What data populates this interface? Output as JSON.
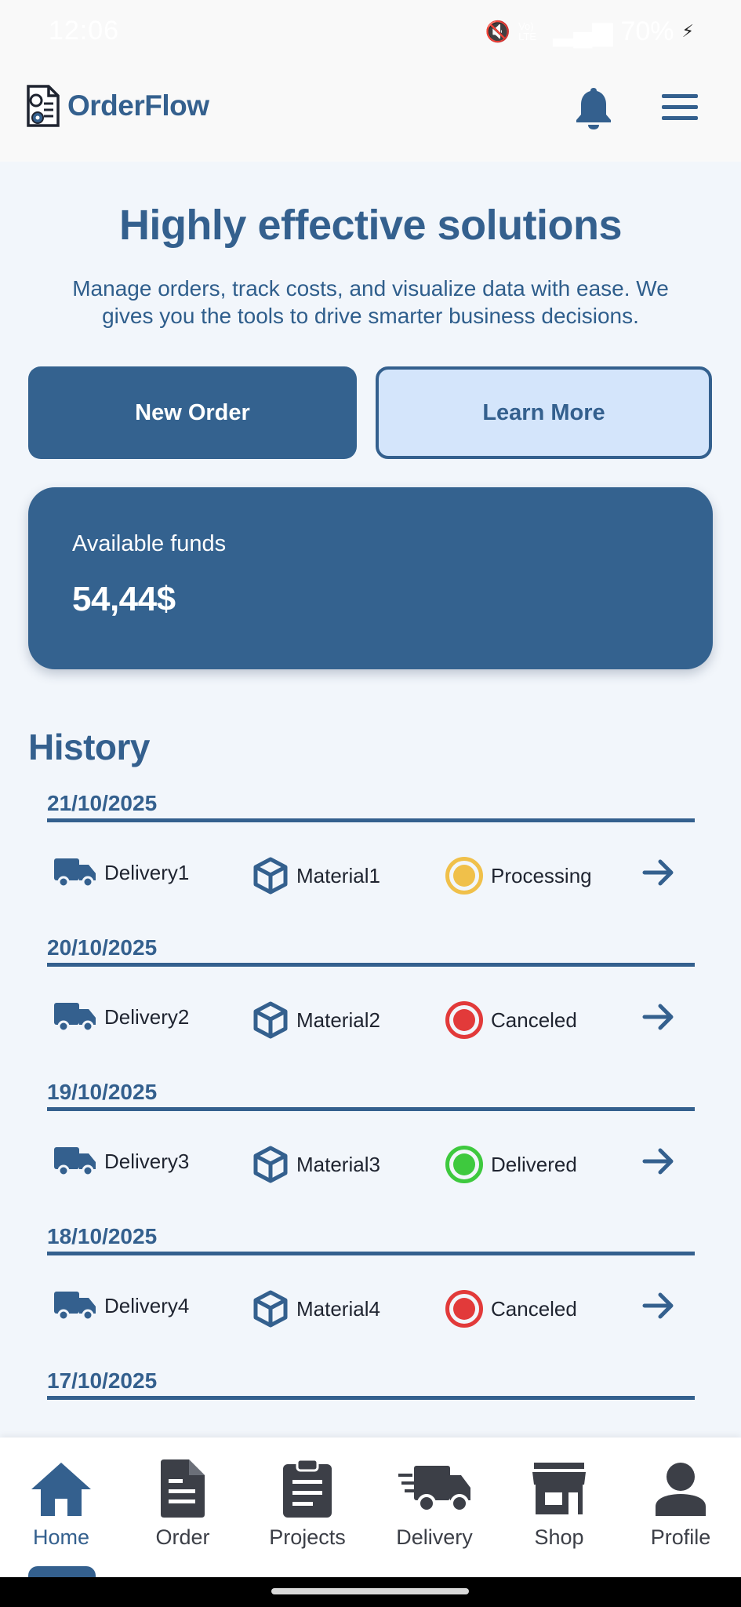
{
  "status_bar": {
    "time": "12:06",
    "network": "Vo) LTE",
    "battery": "70%"
  },
  "header": {
    "app_name": "OrderFlow"
  },
  "hero": {
    "title": "Highly effective solutions",
    "subtitle": "Manage orders, track costs, and visualize data with ease. We gives you the tools to drive smarter business decisions."
  },
  "actions": {
    "primary": "New Order",
    "secondary": "Learn More"
  },
  "funds": {
    "label": "Available funds",
    "value": "54,44$"
  },
  "history": {
    "title": "History",
    "groups": [
      {
        "date": "21/10/2025",
        "delivery": "Delivery1",
        "material": "Material1",
        "status": "Processing"
      },
      {
        "date": "20/10/2025",
        "delivery": "Delivery2",
        "material": "Material2",
        "status": "Canceled"
      },
      {
        "date": "19/10/2025",
        "delivery": "Delivery3",
        "material": "Material3",
        "status": "Delivered"
      },
      {
        "date": "18/10/2025",
        "delivery": "Delivery4",
        "material": "Material4",
        "status": "Canceled"
      },
      {
        "date": "17/10/2025"
      }
    ],
    "status_colors": {
      "Processing": "#f0c04a",
      "Canceled": "#e23a3a",
      "Delivered": "#3ec93e"
    }
  },
  "nav": {
    "items": [
      {
        "label": "Home",
        "icon": "home-icon"
      },
      {
        "label": "Order",
        "icon": "document-icon"
      },
      {
        "label": "Projects",
        "icon": "clipboard-icon"
      },
      {
        "label": "Delivery",
        "icon": "truck-icon"
      },
      {
        "label": "Shop",
        "icon": "store-icon"
      },
      {
        "label": "Profile",
        "icon": "person-icon"
      }
    ],
    "active": "Home"
  },
  "colors": {
    "brand": "#34608e",
    "background": "#f2f6fb",
    "secondary_button": "#d4e5fb"
  }
}
